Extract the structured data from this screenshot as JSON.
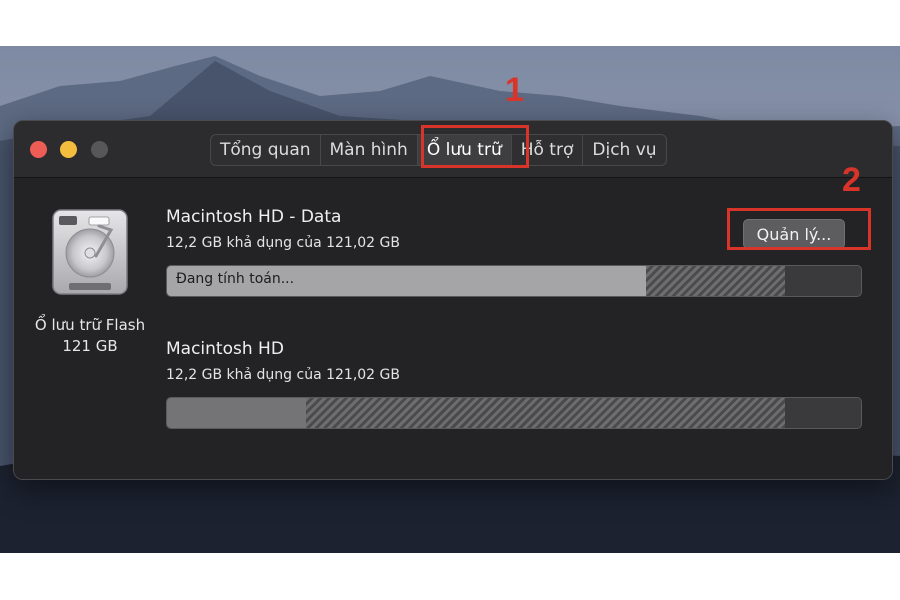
{
  "window": {
    "traffic_lights": [
      "close",
      "minimize",
      "zoom"
    ],
    "tabs": [
      {
        "label": "Tổng quan",
        "active": false
      },
      {
        "label": "Màn hình",
        "active": false
      },
      {
        "label": "Ổ lưu trữ",
        "active": true
      },
      {
        "label": "Hỗ trợ",
        "active": false
      },
      {
        "label": "Dịch vụ",
        "active": false
      }
    ]
  },
  "disk": {
    "icon": "hard-drive-icon",
    "name": "Ổ lưu trữ Flash",
    "size": "121 GB"
  },
  "volumes": [
    {
      "name": "Macintosh HD - Data",
      "availability": "12,2 GB khả dụng của 121,02 GB",
      "bar_status_text": "Đang tính toán...",
      "used_fraction": 0.69,
      "other_fraction": 0.2
    },
    {
      "name": "Macintosh HD",
      "availability": "12,2 GB khả dụng của 121,02 GB",
      "used_fraction": 0.2,
      "other_fraction": 0.69
    }
  ],
  "manage_button": {
    "label": "Quản lý..."
  },
  "annotations": [
    {
      "number": "1",
      "color": "#d8342a"
    },
    {
      "number": "2",
      "color": "#d8342a"
    }
  ]
}
